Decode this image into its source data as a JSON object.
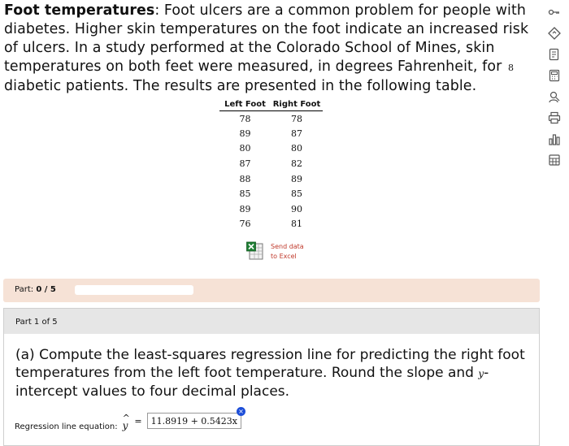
{
  "problem": {
    "title": "Foot temperatures",
    "text": ": Foot ulcers are a common problem for people with diabetes. Higher skin temperatures on the foot indicate an increased risk of ulcers. In a study performed at the Colorado School of Mines, skin temperatures on both feet were measured, in degrees Fahrenheit, for",
    "n": "8",
    "text_end": "diabetic patients. The results are presented in the following table."
  },
  "table": {
    "headers": [
      "Left Foot",
      "Right Foot"
    ],
    "rows": [
      [
        "78",
        "78"
      ],
      [
        "89",
        "87"
      ],
      [
        "80",
        "80"
      ],
      [
        "87",
        "82"
      ],
      [
        "88",
        "89"
      ],
      [
        "85",
        "85"
      ],
      [
        "89",
        "90"
      ],
      [
        "76",
        "81"
      ]
    ]
  },
  "excel": {
    "line1": "Send data",
    "line2": "to Excel"
  },
  "progress": {
    "label": "Part:",
    "value": "0 / 5",
    "fraction": 0
  },
  "part": {
    "header": "Part 1 of 5",
    "question_a": "(a) Compute the least-squares regression line for predicting the right foot temperatures from the left foot temperature. Round the slope and",
    "question_var": "y",
    "question_b": "-intercept values to four decimal places."
  },
  "answer": {
    "label": "Regression line equation:",
    "var": "y",
    "hat": "^",
    "equals": "=",
    "value": "11.8919 + 0.5423x",
    "clear": "×"
  },
  "toolbar": {
    "icons": [
      "key-icon",
      "diamond-icon",
      "notes-icon",
      "calculator-icon",
      "profile-icon",
      "print-icon",
      "chart-icon",
      "grid-icon"
    ]
  },
  "colors": {
    "accent": "#c0392b",
    "part_bar": "#f6e2d6",
    "header_bg": "#e6e6e6",
    "progress": "#2e7d32",
    "clear_dot": "#1d4ed8"
  }
}
